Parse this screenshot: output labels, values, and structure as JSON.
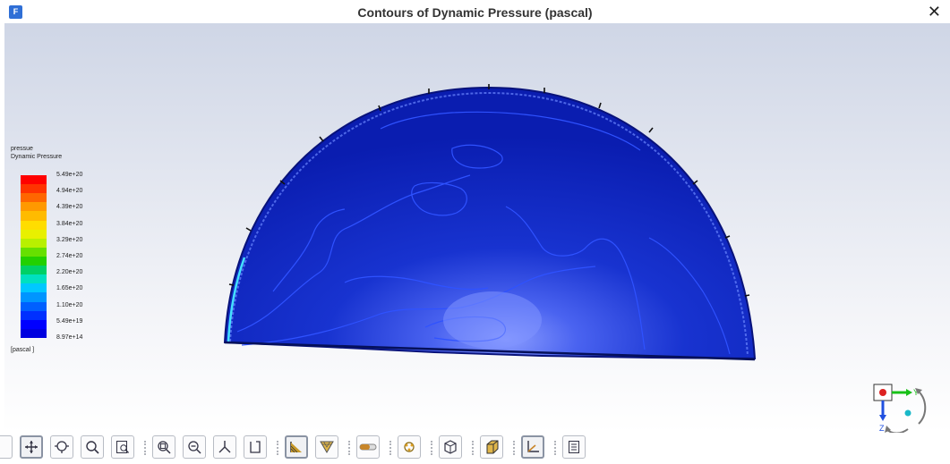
{
  "window": {
    "title": "Contours of Dynamic Pressure (pascal)",
    "app_icon_letter": "F",
    "close_glyph": "✕"
  },
  "legend": {
    "title_line1": "pressue",
    "title_line2": "Dynamic Pressure",
    "unit": "[pascal ]",
    "colors": [
      "#ff0000",
      "#ff3300",
      "#ff6600",
      "#ff9900",
      "#ffbb00",
      "#ffdd00",
      "#e8f000",
      "#b8f000",
      "#66e000",
      "#22d000",
      "#00d066",
      "#00e0c0",
      "#00c8ff",
      "#0095ff",
      "#0060ff",
      "#0030ff",
      "#0000ff",
      "#0000e0"
    ],
    "ticks": [
      "5.49e+20",
      "4.94e+20",
      "4.39e+20",
      "3.84e+20",
      "3.29e+20",
      "2.74e+20",
      "2.20e+20",
      "1.65e+20",
      "1.10e+20",
      "5.49e+19",
      "8.97e+14"
    ]
  },
  "triad": {
    "y_label": "Y",
    "z_label": "Z"
  },
  "toolbar": {
    "items": [
      {
        "name": "partial-tool-button",
        "icon": "partial"
      },
      {
        "name": "pan-button",
        "icon": "pan",
        "active": true
      },
      {
        "name": "zoom-in-out-button",
        "icon": "zoom-in-out"
      },
      {
        "name": "zoom-to-fit-button",
        "icon": "zoom"
      },
      {
        "name": "zoom-box-button",
        "icon": "zoom-box"
      },
      {
        "sep": true
      },
      {
        "name": "fit-to-window-button",
        "icon": "fit"
      },
      {
        "name": "zoom-out-button",
        "icon": "zoom-out"
      },
      {
        "name": "isometric-view-button",
        "icon": "axes-3d"
      },
      {
        "name": "view-direction-button",
        "icon": "view-dir"
      },
      {
        "sep": true
      },
      {
        "name": "contour-display-button",
        "icon": "contour",
        "active": true
      },
      {
        "name": "mesh-display-button",
        "icon": "mesh"
      },
      {
        "sep": true
      },
      {
        "name": "transparency-button",
        "icon": "slider"
      },
      {
        "sep": true
      },
      {
        "name": "lighting-settings-button",
        "icon": "lights"
      },
      {
        "sep": true
      },
      {
        "name": "cube-view-button",
        "icon": "cube"
      },
      {
        "sep": true
      },
      {
        "name": "orthographic-cube-button",
        "icon": "cube-solid"
      },
      {
        "sep": true
      },
      {
        "name": "axes-toggle-button",
        "icon": "axes-2d",
        "active": true
      },
      {
        "sep": true
      },
      {
        "name": "annotation-button",
        "icon": "notes"
      }
    ]
  },
  "colors": {
    "hemisphere_dark": "#0a1fb8",
    "hemisphere_light": "#7a8dff",
    "contour_line": "#2f52ff"
  }
}
